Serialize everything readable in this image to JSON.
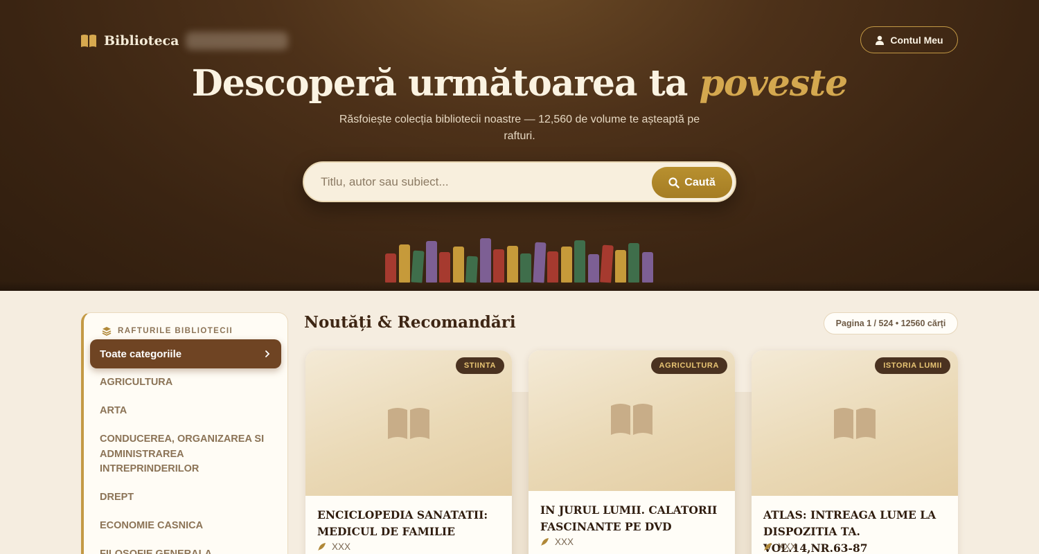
{
  "brand": {
    "name": "Biblioteca",
    "icon": "open-book-icon"
  },
  "header": {
    "account_label": "Contul Meu"
  },
  "hero": {
    "title_main": "Descoperă următoarea ta ",
    "title_accent": "poveste",
    "subtitle": "Răsfoiește colecția bibliotecii noastre — 12,560 de volume te așteaptă pe rafturi."
  },
  "search": {
    "placeholder": "Titlu, autor sau subiect...",
    "button_label": "Caută"
  },
  "shelf_colors": [
    "#a63a2f",
    "#c69a3a",
    "#3f6e4b",
    "#7d5f94",
    "#a63a2f",
    "#c69a3a",
    "#3f6e4b",
    "#7d5f94",
    "#a63a2f",
    "#c69a3a",
    "#3f6e4b",
    "#7d5f94",
    "#a63a2f",
    "#c69a3a",
    "#3f6e4b",
    "#7d5f94",
    "#a63a2f",
    "#c69a3a",
    "#3f6e4b",
    "#7d5f94"
  ],
  "sidebar": {
    "heading": "RAFTURILE BIBLIOTECII",
    "active": "Toate categoriile",
    "items": [
      "AGRICULTURA",
      "ARTA",
      "CONDUCEREA, ORGANIZAREA SI ADMINISTRAREA INTREPRINDERILOR",
      "DREPT",
      "ECONOMIE CASNICA",
      "FILOSOFIE GENERALA"
    ]
  },
  "main": {
    "section_title": "Noutăți & Recomandări",
    "page_info": "Pagina 1 / 524 • 12560 cărți"
  },
  "books": [
    {
      "category": "STIINTA",
      "title": "ENCICLOPEDIA SANATATII: MEDICUL DE FAMILIE",
      "author": "XXX"
    },
    {
      "category": "AGRICULTURA",
      "title": "IN JURUL LUMII. CALATORII FASCINANTE PE DVD",
      "author": "XXX"
    },
    {
      "category": "ISTORIA LUMII",
      "title": "ATLAS: INTREAGA LUME LA DISPOZITIA TA. VOL.14,NR.63-87",
      "author": "XXX"
    }
  ],
  "colors": {
    "hero_bg": "#3a2412",
    "accent_gold": "#c49a45",
    "active_brown": "#6f4423",
    "page_bg": "#f5ede0"
  }
}
